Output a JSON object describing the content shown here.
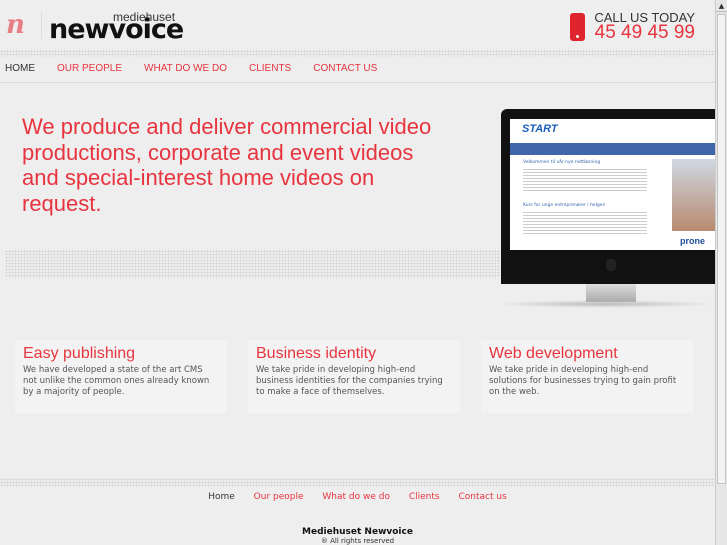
{
  "header": {
    "logo_small": "mediehuset",
    "logo_big": "newvoice",
    "call_label": "CALL US TODAY",
    "phone": "45 49 45 99"
  },
  "nav": [
    "HOME",
    "OUR PEOPLE",
    "WHAT DO WE DO",
    "CLIENTS",
    "CONTACT US"
  ],
  "hero": {
    "text": "We produce and deliver commercial video productions, corporate and event videos and special-interest home videos on request."
  },
  "monitor": {
    "brand": "START",
    "heading1": "Velkommen til vår nye nettløsning",
    "heading2": "Kurs for unge entreprenører i helgen",
    "partner": "prone"
  },
  "features": [
    {
      "title": "Easy publishing",
      "text": "We have developed a state of the art CMS not unlike the common ones already known by a majority of people."
    },
    {
      "title": "Business identity",
      "text": "We take pride in developing high-end business identities for the companies trying to make a face of themselves."
    },
    {
      "title": "Web development",
      "text": "We take pride in developing high-end solutions for businesses trying to gain profit on the web."
    }
  ],
  "footer": {
    "nav": [
      "Home",
      "Our people",
      "What do we do",
      "Clients",
      "Contact us"
    ],
    "company": "Mediehuset Newvoice",
    "rights": "® All rights reserved"
  },
  "colors": {
    "accent": "#e8343f",
    "background": "#eeeeee"
  }
}
